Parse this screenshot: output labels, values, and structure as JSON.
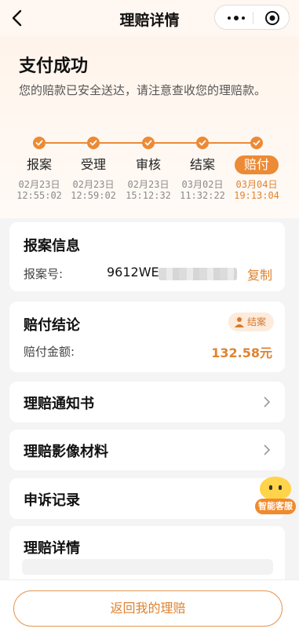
{
  "nav": {
    "title": "理赔详情"
  },
  "hero": {
    "status": "支付成功",
    "desc": "您的赔款已安全送达，请注意查收您的理赔款。"
  },
  "steps": [
    {
      "name": "报案",
      "date": "02月23日",
      "time": "12:55:02",
      "active": false
    },
    {
      "name": "受理",
      "date": "02月23日",
      "time": "12:59:02",
      "active": false
    },
    {
      "name": "审核",
      "date": "02月23日",
      "time": "15:12:32",
      "active": false
    },
    {
      "name": "结案",
      "date": "03月02日",
      "time": "11:32:22",
      "active": false
    },
    {
      "name": "赔付",
      "date": "03月04日",
      "time": "19:13:04",
      "active": true
    }
  ],
  "report": {
    "title": "报案信息",
    "case_label": "报案号:",
    "case_no": "9612WE",
    "copy_label": "复制"
  },
  "conclusion": {
    "title": "赔付结论",
    "badge": "结案",
    "amount_label": "赔付金额:",
    "amount": "132.58元"
  },
  "links": {
    "notice": "理赔通知书",
    "materials": "理赔影像材料",
    "appeal": "申诉记录",
    "details": "理赔详情"
  },
  "assistant": {
    "label": "智能客服"
  },
  "footer": {
    "button": "返回我的理赔"
  },
  "colors": {
    "accent": "#ec8a35",
    "background": "#f4f4f4"
  }
}
